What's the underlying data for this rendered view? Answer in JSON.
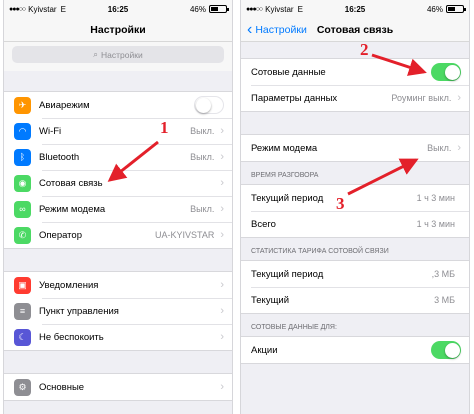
{
  "left": {
    "status": {
      "carrier": "Kyivstar",
      "network": "E",
      "time": "16:25",
      "battery": "46%"
    },
    "title": "Настройки",
    "search_placeholder": "Настройки",
    "group1": [
      {
        "label": "Авиарежим",
        "icon": "airplane-icon",
        "icon_color": "#ff9500",
        "glyph": "✈",
        "control": "toggle-off"
      },
      {
        "label": "Wi-Fi",
        "icon": "wifi-icon",
        "icon_color": "#007aff",
        "glyph": "◠",
        "value": "Выкл."
      },
      {
        "label": "Bluetooth",
        "icon": "bluetooth-icon",
        "icon_color": "#007aff",
        "glyph": "ᛒ",
        "value": "Выкл."
      },
      {
        "label": "Сотовая связь",
        "icon": "cellular-icon",
        "icon_color": "#4cd964",
        "glyph": "◉"
      },
      {
        "label": "Режим модема",
        "icon": "hotspot-icon",
        "icon_color": "#4cd964",
        "glyph": "∞",
        "value": "Выкл."
      },
      {
        "label": "Оператор",
        "icon": "phone-icon",
        "icon_color": "#4cd964",
        "glyph": "✆",
        "value": "UA-KYIVSTAR"
      }
    ],
    "group2": [
      {
        "label": "Уведомления",
        "icon": "notifications-icon",
        "icon_color": "#ff3b30",
        "glyph": "▣"
      },
      {
        "label": "Пункт управления",
        "icon": "control-center-icon",
        "icon_color": "#8e8e93",
        "glyph": "≡"
      },
      {
        "label": "Не беспокоить",
        "icon": "moon-icon",
        "icon_color": "#5856d6",
        "glyph": "☾"
      }
    ],
    "group3": [
      {
        "label": "Основные",
        "icon": "gear-icon",
        "icon_color": "#8e8e93",
        "glyph": "⚙"
      }
    ]
  },
  "right": {
    "status": {
      "carrier": "Kyivstar",
      "network": "E",
      "time": "16:25",
      "battery": "46%"
    },
    "back_label": "Настройки",
    "title": "Сотовая связь",
    "rows1": [
      {
        "label": "Сотовые данные",
        "control": "toggle-on"
      },
      {
        "label": "Параметры данных",
        "value": "Роуминг выкл."
      }
    ],
    "rows2": [
      {
        "label": "Режим модема",
        "value": "Выкл."
      }
    ],
    "section_talk": "ВРЕМЯ РАЗГОВОРА",
    "rows3": [
      {
        "label": "Текущий период",
        "value": "1 ч 3 мин"
      },
      {
        "label": "Всего",
        "value": "1 ч 3 мин"
      }
    ],
    "section_tariff": "СТАТИСТИКА ТАРИФА СОТОВОЙ СВЯЗИ",
    "rows4": [
      {
        "label": "Текущий период",
        "value": ",3 МБ"
      },
      {
        "label": "Текущий",
        "value": "3 МБ"
      }
    ],
    "section_apps": "СОТОВЫЕ ДАННЫЕ ДЛЯ:",
    "rows5": [
      {
        "label": "Акции",
        "control": "toggle-on"
      }
    ]
  },
  "annotations": [
    "1",
    "2",
    "3"
  ],
  "colors": {
    "accent": "#007aff",
    "toggle_on": "#4cd964",
    "arrow": "#e3202a"
  }
}
